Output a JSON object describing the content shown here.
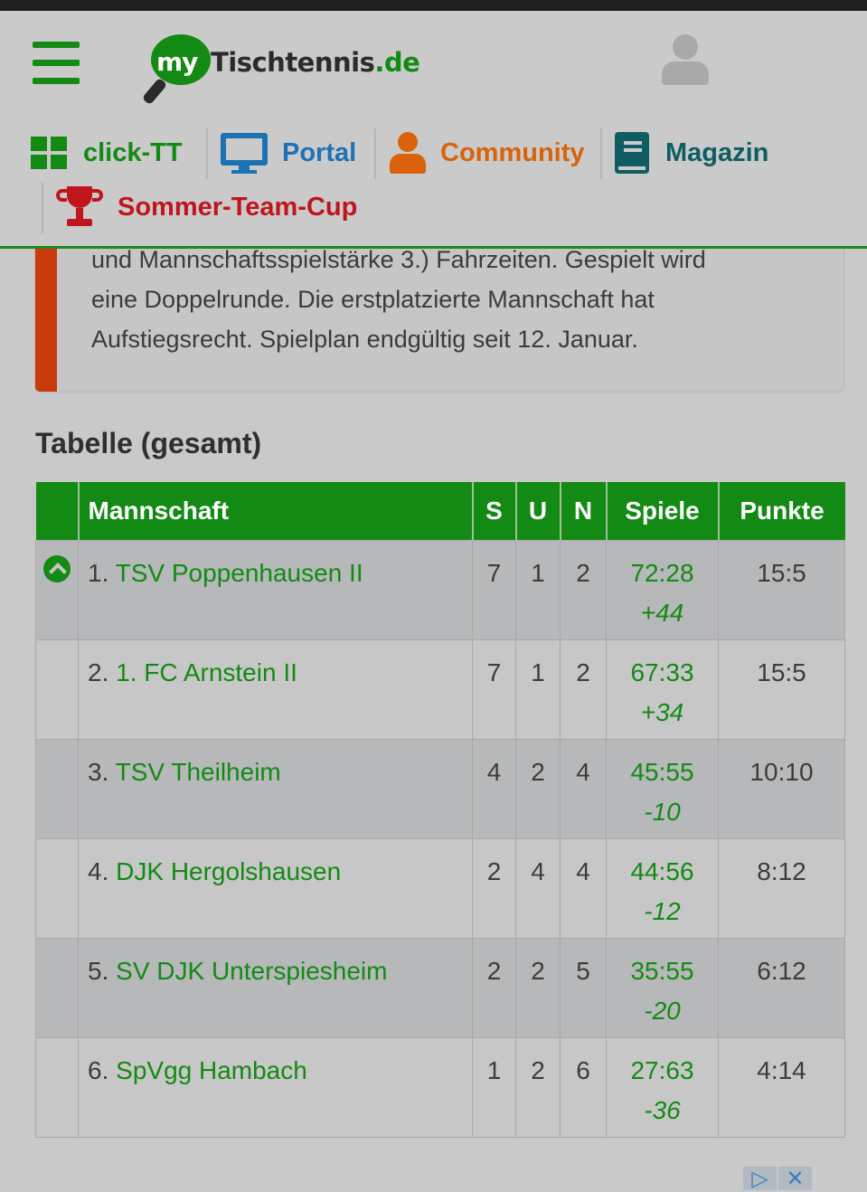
{
  "header": {
    "logo": {
      "prefix": "my",
      "name": "Tischtennis",
      "tld": ".de"
    },
    "nav": [
      {
        "label": "click-TT",
        "color": "#138a13",
        "icon": "grid-icon"
      },
      {
        "label": "Portal",
        "color": "#1c73b4",
        "icon": "monitor-icon"
      },
      {
        "label": "Community",
        "color": "#d9620b",
        "icon": "person-icon"
      },
      {
        "label": "Magazin",
        "color": "#0f5d63",
        "icon": "book-icon"
      },
      {
        "label": "Sommer-Team-Cup",
        "color": "#c0151c",
        "icon": "trophy-icon"
      }
    ]
  },
  "info": {
    "lines": [
      "und Mannschaftsspielstärke 3.) Fahrzeiten. Gespielt wird",
      "eine Doppelrunde. Die erstplatzierte Mannschaft hat",
      "Aufstiegsrecht. Spielplan endgültig seit 12. Januar."
    ]
  },
  "table": {
    "title": "Tabelle (gesamt)",
    "columns": {
      "team": "Mannschaft",
      "s": "S",
      "u": "U",
      "n": "N",
      "spiele": "Spiele",
      "punkte": "Punkte"
    },
    "rows": [
      {
        "rank": "1.",
        "team": "TSV Poppenhausen II",
        "s": "7",
        "u": "1",
        "n": "2",
        "spiele": "72:28",
        "diff": "+44",
        "punkte": "15:5",
        "promoted": true
      },
      {
        "rank": "2.",
        "team": "1. FC Arnstein II",
        "s": "7",
        "u": "1",
        "n": "2",
        "spiele": "67:33",
        "diff": "+34",
        "punkte": "15:5"
      },
      {
        "rank": "3.",
        "team": "TSV Theilheim",
        "s": "4",
        "u": "2",
        "n": "4",
        "spiele": "45:55",
        "diff": "-10",
        "punkte": "10:10"
      },
      {
        "rank": "4.",
        "team": "DJK Hergolshausen",
        "s": "2",
        "u": "4",
        "n": "4",
        "spiele": "44:56",
        "diff": "-12",
        "punkte": "8:12"
      },
      {
        "rank": "5.",
        "team": "SV DJK Unterspiesheim",
        "s": "2",
        "u": "2",
        "n": "5",
        "spiele": "35:55",
        "diff": "-20",
        "punkte": "6:12"
      },
      {
        "rank": "6.",
        "team": "SpVgg Hambach",
        "s": "1",
        "u": "2",
        "n": "6",
        "spiele": "27:63",
        "diff": "-36",
        "punkte": "4:14"
      }
    ]
  },
  "colors": {
    "accent": "#138a13",
    "info_bar": "#c93a0d",
    "odd_row": "#b6b8ba",
    "even_row": "#c7c7c7"
  }
}
